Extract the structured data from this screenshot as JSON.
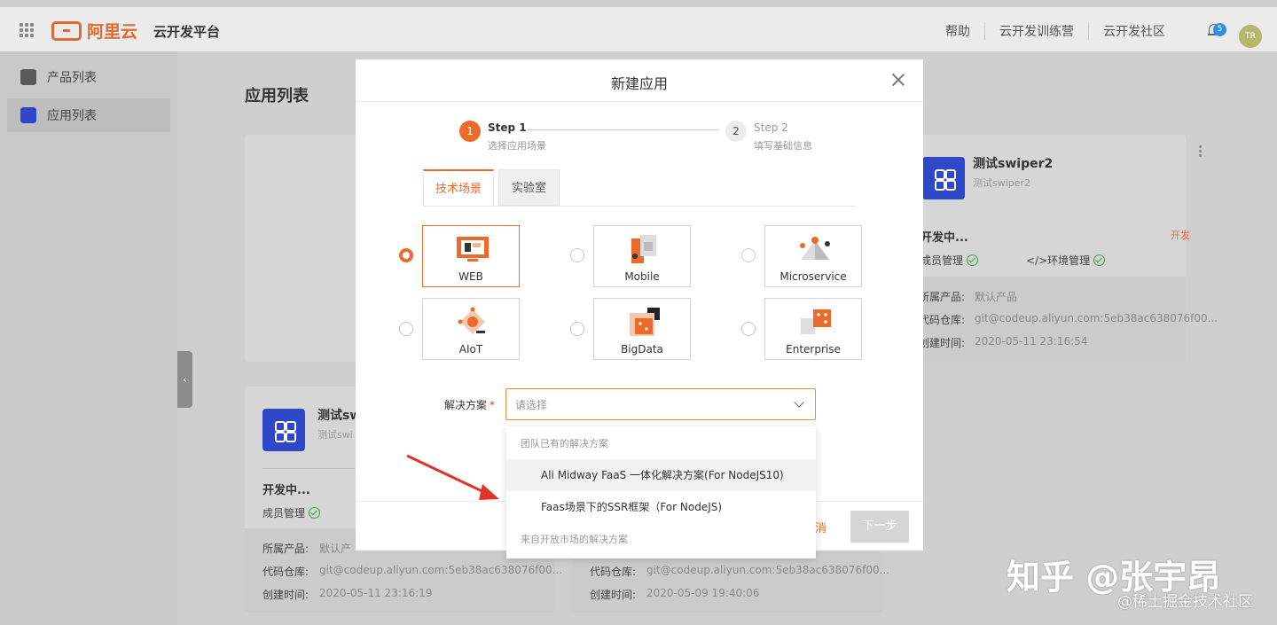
{
  "topbar": {
    "brand": "阿里云",
    "platform_name": "云开发平台",
    "links": [
      "帮助",
      "云开发训练营",
      "云开发社区"
    ],
    "notification_count": "5",
    "avatar_initials": "TR"
  },
  "sidebar": {
    "items": [
      {
        "label": "产品列表",
        "icon": "box-icon"
      },
      {
        "label": "应用列表",
        "icon": "apps-icon"
      }
    ]
  },
  "page": {
    "title": "应用列表"
  },
  "cards": [
    {
      "name": "测试swiper2",
      "subtitle": "测试swiper2",
      "status": "开发中...",
      "status_tag": "开发",
      "member_mgmt": "成员管理",
      "env_mgmt": "</>环境管理",
      "product_label": "所属产品:",
      "product_value": "默认产品",
      "repo_label": "代码仓库:",
      "repo_value": "git@codeup.aliyun.com:5eb38ac638076f00...",
      "created_label": "创建时间:",
      "created_value": "2020-05-11 23:16:54"
    },
    {
      "name": "测试sw",
      "subtitle": "测试swi",
      "status": "开发中...",
      "member_mgmt": "成员管理",
      "product_label": "所属产品:",
      "product_value": "默认产",
      "repo_label": "代码仓库:",
      "repo_value": "git@codeup.aliyun.com:5eb38ac638076f00...",
      "created_label": "创建时间:",
      "created_value": "2020-05-11 23:16:19"
    },
    {
      "repo_label": "代码仓库:",
      "repo_value": "git@codeup.aliyun.com:5eb38ac638076f00...",
      "created_label": "创建时间:",
      "created_value": "2020-05-09 19:40:06"
    }
  ],
  "modal": {
    "title": "新建应用",
    "steps": [
      {
        "number": "1",
        "title": "Step 1",
        "desc": "选择应用场景"
      },
      {
        "number": "2",
        "title": "Step 2",
        "desc": "填写基础信息"
      }
    ],
    "tabs": [
      {
        "label": "技术场景",
        "active": true
      },
      {
        "label": "实验室",
        "active": false
      }
    ],
    "scenarios": [
      {
        "label": "WEB",
        "selected": true
      },
      {
        "label": "Mobile",
        "selected": false
      },
      {
        "label": "Microservice",
        "selected": false
      },
      {
        "label": "AIoT",
        "selected": false
      },
      {
        "label": "BigData",
        "selected": false
      },
      {
        "label": "Enterprise",
        "selected": false
      }
    ],
    "solution_label": "解决方案",
    "solution_required": "*",
    "solution_placeholder": "请选择",
    "cancel_label": "消",
    "next_label": "下一步"
  },
  "dropdown": {
    "group1": "团队已有的解决方案",
    "options": [
      "Ali Midway FaaS 一体化解决方案(For NodeJS10)",
      "Faas场景下的SSR框架（For NodeJS)"
    ],
    "group2": "来自开放市场的解决方案"
  },
  "watermark": {
    "main": "知乎 @张宇昂",
    "sub": "@稀土掘金技术社区"
  },
  "colors": {
    "accent": "#ee6a2a",
    "app_icon": "#2f48c9",
    "ok_green": "#3ca04a",
    "annotation_arrow": "#e0342b"
  }
}
